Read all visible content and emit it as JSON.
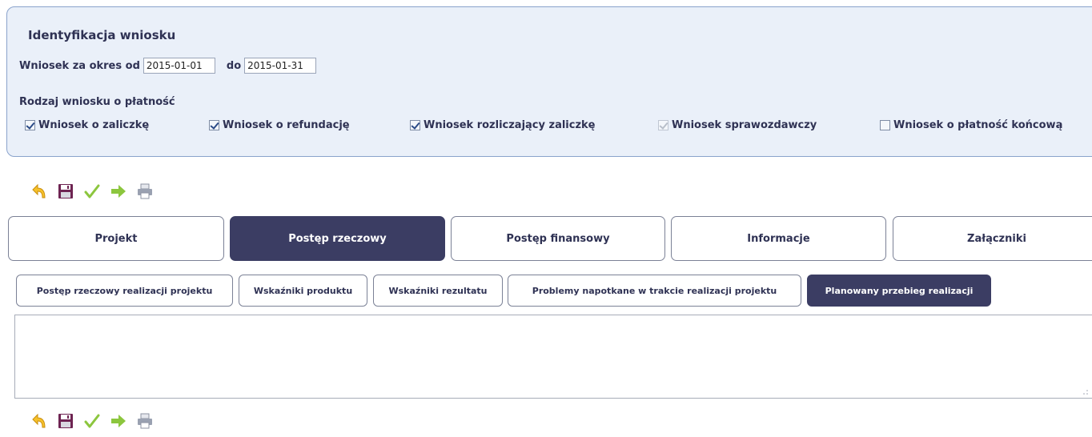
{
  "ident": {
    "title": "Identyfikacja wniosku",
    "period_label": "Wniosek za okres od",
    "date_from": "2015-01-01",
    "to_label": "do",
    "date_to": "2015-01-31",
    "type_label": "Rodzaj wniosku o płatność",
    "types": [
      {
        "label": "Wniosek o zaliczkę",
        "checked": true,
        "disabled": false
      },
      {
        "label": "Wniosek o refundację",
        "checked": true,
        "disabled": false
      },
      {
        "label": "Wniosek rozliczający zaliczkę",
        "checked": true,
        "disabled": false
      },
      {
        "label": "Wniosek sprawozdawczy",
        "checked": true,
        "disabled": true
      },
      {
        "label": "Wniosek o płatność końcową",
        "checked": false,
        "disabled": false
      }
    ]
  },
  "toolbar_icons": [
    "undo-icon",
    "save-icon",
    "check-icon",
    "forward-arrow-icon",
    "print-icon"
  ],
  "tabs": [
    {
      "label": "Projekt",
      "active": false
    },
    {
      "label": "Postęp rzeczowy",
      "active": true
    },
    {
      "label": "Postęp finansowy",
      "active": false
    },
    {
      "label": "Informacje",
      "active": false
    },
    {
      "label": "Załączniki",
      "active": false
    }
  ],
  "subtabs": [
    {
      "label": "Postęp rzeczowy realizacji projektu",
      "active": false
    },
    {
      "label": "Wskaźniki produktu",
      "active": false
    },
    {
      "label": "Wskaźniki rezultatu",
      "active": false
    },
    {
      "label": "Problemy napotkane w trakcie realizacji projektu",
      "active": false
    },
    {
      "label": "Planowany przebieg realizacji",
      "active": true
    }
  ],
  "colors": {
    "panel_bg": "#eaf0f9",
    "panel_border": "#8aa3cc",
    "tab_active_bg": "#3b3d63",
    "text": "#2f3254"
  }
}
